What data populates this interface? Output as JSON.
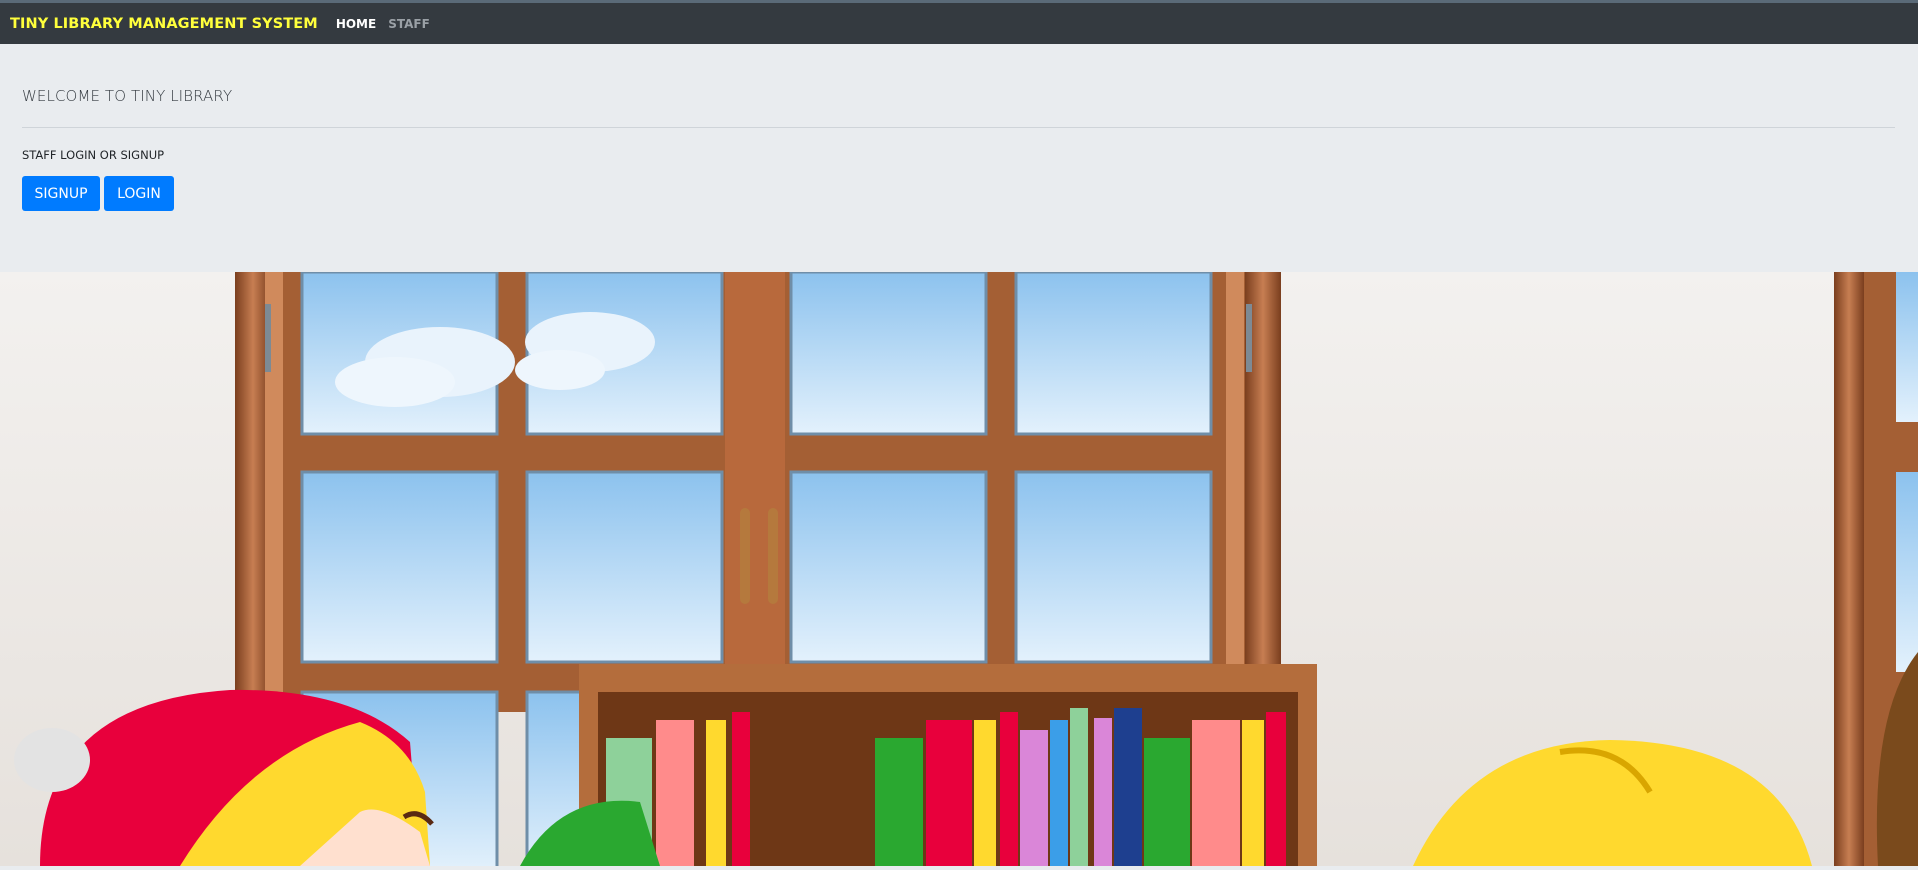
{
  "navbar": {
    "brand": "TINY LIBRARY MANAGEMENT SYSTEM",
    "links": [
      {
        "label": "HOME",
        "active": true
      },
      {
        "label": "STAFF",
        "active": false
      }
    ]
  },
  "jumbotron": {
    "heading": "WELCOME TO TINY LIBRARY",
    "subheading": "STAFF LOGIN OR SIGNUP",
    "signup_label": "SIGNUP",
    "login_label": "LOGIN"
  },
  "colors": {
    "navbar_bg": "#343a40",
    "brand": "#ffff3c",
    "jumbotron_bg": "#e9ecef",
    "button": "#007bff"
  },
  "illustration": {
    "subject": "cartoon library room with windows, bookshelf and children"
  }
}
